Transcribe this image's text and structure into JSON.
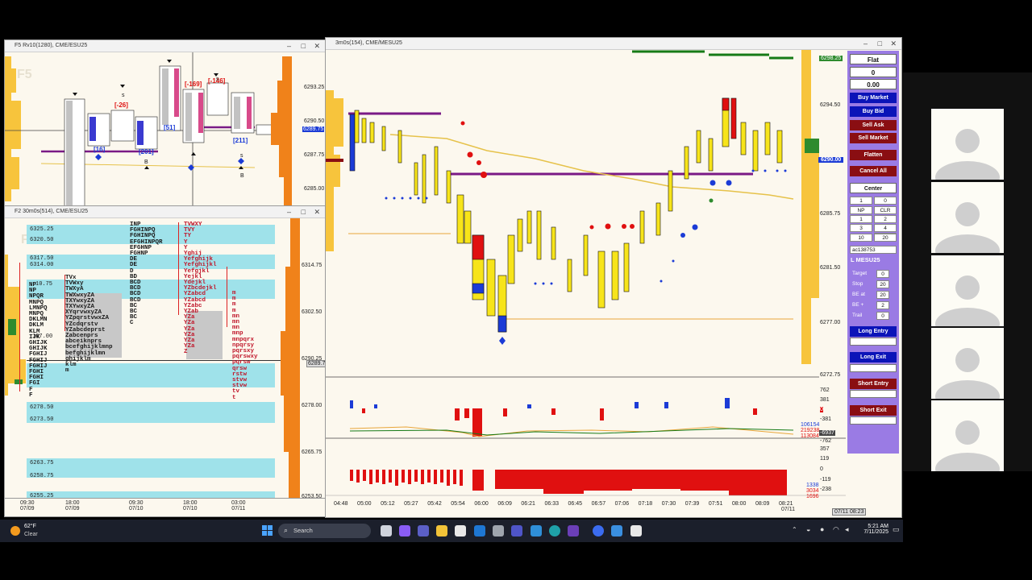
{
  "win_f5": {
    "title": "F5 Rv10(1280), CME/ESU25",
    "watermark": "F5",
    "prices": [
      "6293.25",
      "6290.50",
      "6287.75",
      "6285.00"
    ],
    "current_price": "6289.75",
    "callouts": [
      "[-26]",
      "[-169]",
      "[-146]",
      "[16]",
      "[201]",
      "[51]",
      "[211]"
    ]
  },
  "win_f2": {
    "title": "F2 30m0s(514), CME/ESU25",
    "watermark": "F",
    "prices": [
      "6314.75",
      "6302.50",
      "6290.25",
      "6278.00",
      "6265.75",
      "6253.50"
    ],
    "current_price": "6289.75",
    "levels": [
      "6325.25",
      "6320.50",
      "6317.50",
      "6314.00",
      "10.75",
      "107.00",
      "6278.50",
      "6273.50",
      "6263.75",
      "6258.75",
      "6255.25"
    ],
    "time_labels": [
      {
        "time": "09:30",
        "date": "07/09"
      },
      {
        "time": "18:00",
        "date": "07/09"
      },
      {
        "time": "09:30",
        "date": "07/10"
      },
      {
        "time": "18:00",
        "date": "07/10"
      },
      {
        "time": "03:00",
        "date": "07/11"
      }
    ],
    "tpo_col1": "NP\nNP\nNPQR\nMNPQ\nLMNPQ\nMNPQ\nDKLMN\nDKLM\nKLM\nIJK\nGHIJK\nGHIJK\nFGHIJ\nFGHIJ\nFGHIJ\nFGHI\nFGHI\nFGI\nF\nF",
    "tpo_col2": "TVx\nTVWxy\nTWXyA\nTWXwxyZA\nTXYwxyZA\nTXYwxyZA\nXYqrvwxyZA\nYZpqrstvwxZA\nYZcdqrstv\nYZabcdeprst\nZabcenprs\nabceiknprs\nbcefghijklmnp\nbefghijklmn\nghijklm\nklm\nm",
    "tpo_col3": "INP\nFGHINPQ\nFGHINPQ\nEFGHINPQR\nEFGHNP\nFGHNP\nDE\nDE\nD\nBD\nBCD\nBCD\nBCD\nBCD\nBC\nBC\nBC\nC",
    "tpo_col4": "TVWXY\nTVY\nTY\nY\nY\nYghij\nYefghijk\nYefghijkl\nYefgjkl\nYejkl\nYdejkl\nYZbcdejkl\nYZabcd\nYZabcd\nYZabc\nYZab\nYZa\nYZa\nYZa\nYZa\nYZa\nYZa\nZ",
    "tpo_col5": "m\nm\nm\nm\nmn\nmn\nmn\nmnp\nmnpqrx\nnpqrsy\npqrsxy\npqrswxy\npqrsw\nqrsw\nrstw\nstvw\nstvw\ntv\nt"
  },
  "win_main": {
    "title": "3m0s(154), CME/MESU25",
    "prices": [
      "6294.50",
      "6290.00",
      "6285.75",
      "6281.50",
      "6277.00",
      "6272.75"
    ],
    "current_price": "6290.00",
    "top_price": "6298.25",
    "times": [
      "04:48",
      "05:00",
      "05:12",
      "05:27",
      "05:42",
      "05:54",
      "06:00",
      "06:09",
      "06:21",
      "06:33",
      "06:45",
      "06:57",
      "07:06",
      "07:18",
      "07:30",
      "07:39",
      "07:51",
      "08:00",
      "08:09",
      "08:21"
    ],
    "last_date": "07/11",
    "status_time": "07/11 08:23",
    "delta_axis": [
      "762",
      "381",
      "0",
      "-381",
      "-762"
    ],
    "delta_vals": [
      "106154",
      "219238",
      "113084",
      "-6937"
    ],
    "cum_axis": [
      "357",
      "119",
      "0",
      "-119",
      "-238"
    ],
    "cum_vals": [
      "1338",
      "3034",
      "1696"
    ]
  },
  "panel": {
    "position": "Flat",
    "qty": "0",
    "pnl": "0.00",
    "buy_market": "Buy Market",
    "buy_bid": "Buy Bid",
    "sell_ask": "Sell Ask",
    "sell_market": "Sell Market",
    "flatten": "Flatten",
    "cancel_all": "Cancel All",
    "center": "Center",
    "qty_left": "1",
    "qty_right": "0",
    "np": "NP",
    "clr": "CLR",
    "grid": [
      "1",
      "2",
      "3",
      "4",
      "8",
      "10",
      "20"
    ],
    "account": "ac138753",
    "instrument": "L MESU25",
    "target_label": "Target",
    "target_val": "0",
    "stop_label": "Stop",
    "stop_val": "20",
    "beat_label": "BE at",
    "beat_val": "20",
    "beplus_label": "BE +",
    "beplus_val": "2",
    "trail_label": "Trail",
    "trail_val": "0",
    "long_entry": "Long Entry",
    "long_exit": "Long Exit",
    "short_entry": "Short Entry",
    "short_exit": "Short Exit",
    "colors": {
      "blue": "#0b14b8",
      "red": "#8a0e12",
      "purple": "#9a7be4"
    }
  },
  "taskbar": {
    "temp": "62°F",
    "weather": "Clear",
    "search": "Search",
    "time": "5:21 AM",
    "date": "7/11/2025"
  }
}
